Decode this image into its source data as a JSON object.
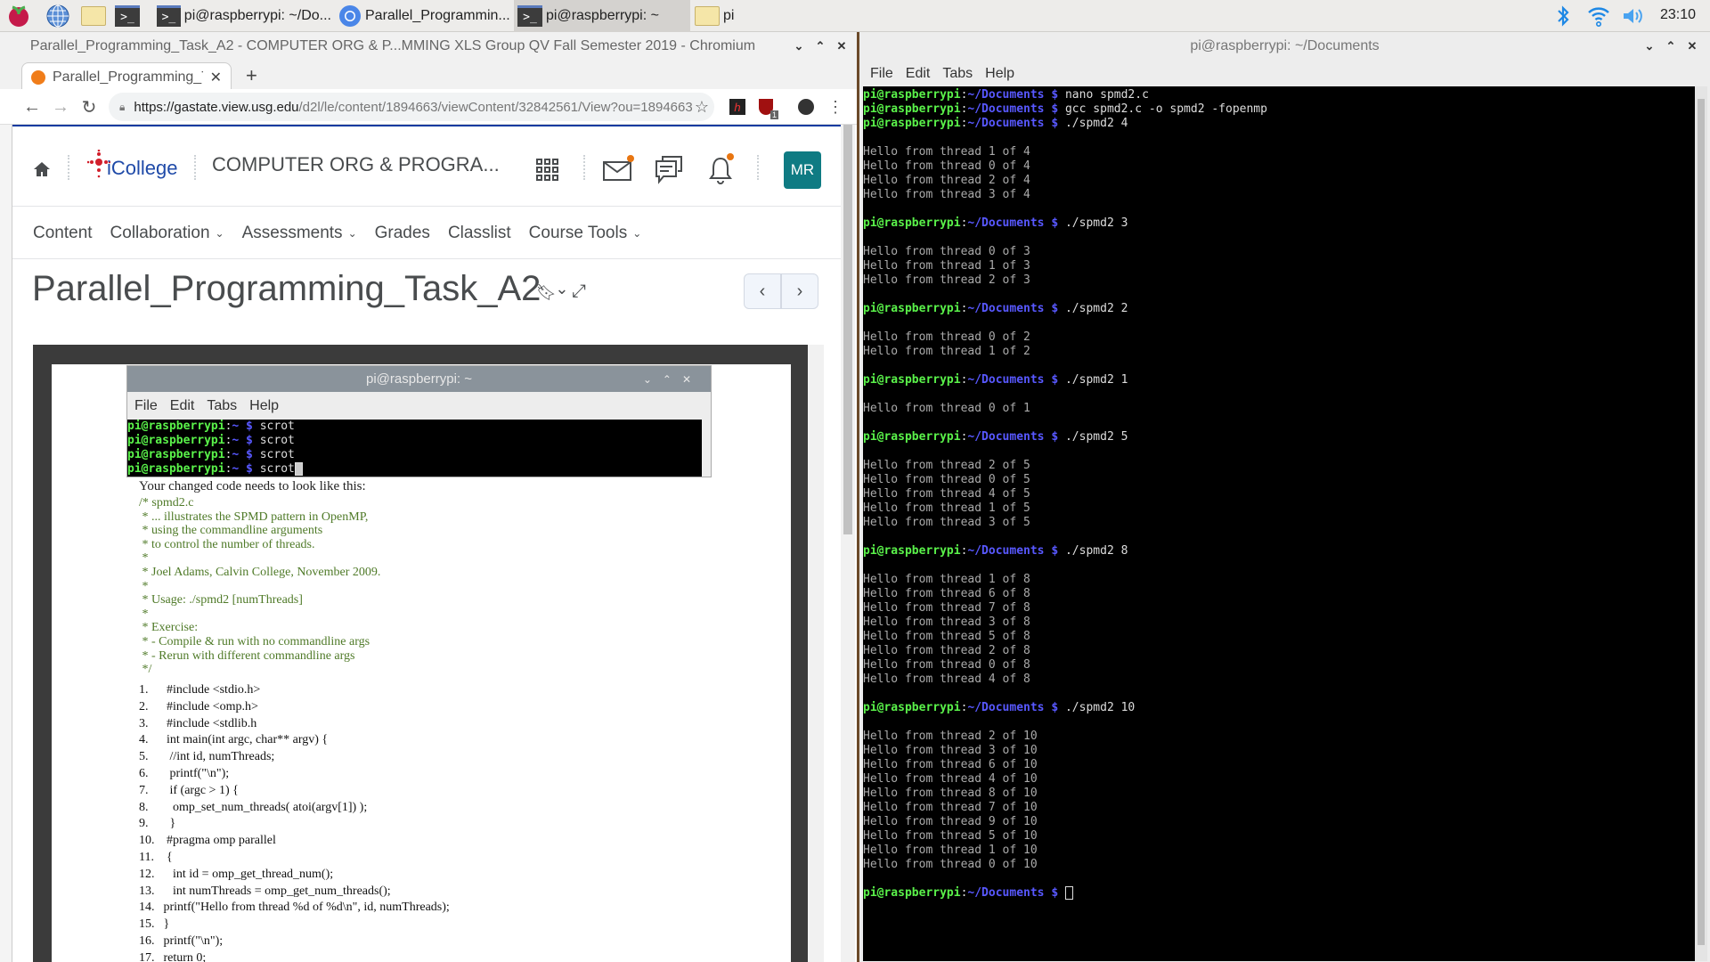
{
  "taskbar": {
    "tasks": [
      {
        "label": "pi@raspberrypi: ~/Do..."
      },
      {
        "label": "Parallel_Programmin..."
      },
      {
        "label": "pi@raspberrypi: ~"
      },
      {
        "label": "pi"
      }
    ],
    "clock": "23:10"
  },
  "browser": {
    "window_title": "Parallel_Programming_Task_A2 - COMPUTER ORG & P...MMING XLS Group QV Fall Semester 2019 - Chromium",
    "tab_label": "Parallel_Programming_Ta",
    "url_host": "https://gastate.view.usg.edu",
    "url_path": "/d2l/le/content/1894663/viewContent/32842561/View?ou=1894663",
    "extension_badge": "1"
  },
  "icollege": {
    "logo_text": "iCollege",
    "course_title": "COMPUTER ORG & PROGRA...",
    "avatar": "MR",
    "nav": [
      "Content",
      "Collaboration",
      "Assessments",
      "Grades",
      "Classlist",
      "Course Tools"
    ],
    "page_title": "Parallel_Programming_Task_A2"
  },
  "document": {
    "intro": "Your changed code needs to look like this:",
    "comment_lines": [
      "/* spmd2.c",
      " * ... illustrates the SPMD pattern in OpenMP,",
      " * using the commandline arguments",
      " * to control the number of threads.",
      " *",
      " * Joel Adams, Calvin College, November 2009.",
      " *",
      " * Usage: ./spmd2 [numThreads]",
      " *",
      " * Exercise:",
      " * - Compile & run with no commandline args",
      " * - Rerun with different commandline args",
      " */"
    ],
    "code_lines": [
      {
        "n": "1.",
        "t": "  #include <stdio.h>"
      },
      {
        "n": "2.",
        "t": "  #include <omp.h>"
      },
      {
        "n": "3.",
        "t": "  #include <stdlib.h"
      },
      {
        "n": "4.",
        "t": "  int main(int argc, char** argv) {"
      },
      {
        "n": "5.",
        "t": "   //int id, numThreads;"
      },
      {
        "n": "6.",
        "t": "   printf(\"\\n\");"
      },
      {
        "n": "7.",
        "t": "   if (argc > 1) {"
      },
      {
        "n": "8.",
        "t": "    omp_set_num_threads( atoi(argv[1]) );"
      },
      {
        "n": "9.",
        "t": "   }"
      },
      {
        "n": "10.",
        "t": "  #pragma omp parallel"
      },
      {
        "n": "11.",
        "t": "  {"
      },
      {
        "n": "12.",
        "t": "    int id = omp_get_thread_num();"
      },
      {
        "n": "13.",
        "t": "    int numThreads = omp_get_num_threads();"
      },
      {
        "n": "14.",
        "t": " printf(\"Hello from thread %d of %d\\n\", id, numThreads);"
      },
      {
        "n": "15.",
        "t": " }"
      },
      {
        "n": "16.",
        "t": " printf(\"\\n\");"
      },
      {
        "n": "17.",
        "t": " return 0;"
      }
    ]
  },
  "embedded_terminal": {
    "title": "pi@raspberrypi: ~",
    "menu": [
      "File",
      "Edit",
      "Tabs",
      "Help"
    ],
    "user": "pi@raspberrypi",
    "path": "~",
    "lines": [
      "scrot",
      "scrot",
      "scrot",
      "scrot"
    ]
  },
  "terminal": {
    "title": "pi@raspberrypi: ~/Documents",
    "menu": [
      "File",
      "Edit",
      "Tabs",
      "Help"
    ],
    "user": "pi@raspberrypi",
    "path": "~/Documents",
    "lines": [
      {
        "k": "p",
        "t": "nano spmd2.c"
      },
      {
        "k": "p",
        "t": "gcc spmd2.c -o spmd2 -fopenmp"
      },
      {
        "k": "p",
        "t": "./spmd2 4"
      },
      {
        "k": "b"
      },
      {
        "k": "o",
        "t": "Hello from thread 1 of 4"
      },
      {
        "k": "o",
        "t": "Hello from thread 0 of 4"
      },
      {
        "k": "o",
        "t": "Hello from thread 2 of 4"
      },
      {
        "k": "o",
        "t": "Hello from thread 3 of 4"
      },
      {
        "k": "b"
      },
      {
        "k": "p",
        "t": "./spmd2 3"
      },
      {
        "k": "b"
      },
      {
        "k": "o",
        "t": "Hello from thread 0 of 3"
      },
      {
        "k": "o",
        "t": "Hello from thread 1 of 3"
      },
      {
        "k": "o",
        "t": "Hello from thread 2 of 3"
      },
      {
        "k": "b"
      },
      {
        "k": "p",
        "t": "./spmd2 2"
      },
      {
        "k": "b"
      },
      {
        "k": "o",
        "t": "Hello from thread 0 of 2"
      },
      {
        "k": "o",
        "t": "Hello from thread 1 of 2"
      },
      {
        "k": "b"
      },
      {
        "k": "p",
        "t": "./spmd2 1"
      },
      {
        "k": "b"
      },
      {
        "k": "o",
        "t": "Hello from thread 0 of 1"
      },
      {
        "k": "b"
      },
      {
        "k": "p",
        "t": "./spmd2 5"
      },
      {
        "k": "b"
      },
      {
        "k": "o",
        "t": "Hello from thread 2 of 5"
      },
      {
        "k": "o",
        "t": "Hello from thread 0 of 5"
      },
      {
        "k": "o",
        "t": "Hello from thread 4 of 5"
      },
      {
        "k": "o",
        "t": "Hello from thread 1 of 5"
      },
      {
        "k": "o",
        "t": "Hello from thread 3 of 5"
      },
      {
        "k": "b"
      },
      {
        "k": "p",
        "t": "./spmd2 8"
      },
      {
        "k": "b"
      },
      {
        "k": "o",
        "t": "Hello from thread 1 of 8"
      },
      {
        "k": "o",
        "t": "Hello from thread 6 of 8"
      },
      {
        "k": "o",
        "t": "Hello from thread 7 of 8"
      },
      {
        "k": "o",
        "t": "Hello from thread 3 of 8"
      },
      {
        "k": "o",
        "t": "Hello from thread 5 of 8"
      },
      {
        "k": "o",
        "t": "Hello from thread 2 of 8"
      },
      {
        "k": "o",
        "t": "Hello from thread 0 of 8"
      },
      {
        "k": "o",
        "t": "Hello from thread 4 of 8"
      },
      {
        "k": "b"
      },
      {
        "k": "p",
        "t": "./spmd2 10"
      },
      {
        "k": "b"
      },
      {
        "k": "o",
        "t": "Hello from thread 2 of 10"
      },
      {
        "k": "o",
        "t": "Hello from thread 3 of 10"
      },
      {
        "k": "o",
        "t": "Hello from thread 6 of 10"
      },
      {
        "k": "o",
        "t": "Hello from thread 4 of 10"
      },
      {
        "k": "o",
        "t": "Hello from thread 8 of 10"
      },
      {
        "k": "o",
        "t": "Hello from thread 7 of 10"
      },
      {
        "k": "o",
        "t": "Hello from thread 9 of 10"
      },
      {
        "k": "o",
        "t": "Hello from thread 5 of 10"
      },
      {
        "k": "o",
        "t": "Hello from thread 1 of 10"
      },
      {
        "k": "o",
        "t": "Hello from thread 0 of 10"
      },
      {
        "k": "b"
      },
      {
        "k": "c",
        "t": ""
      }
    ]
  },
  "colors": {
    "accent": "#0a3aa0",
    "avatar": "#0f7b83",
    "notify": "#e87511",
    "prompt_user": "#5af24a",
    "prompt_path": "#5858ff"
  }
}
